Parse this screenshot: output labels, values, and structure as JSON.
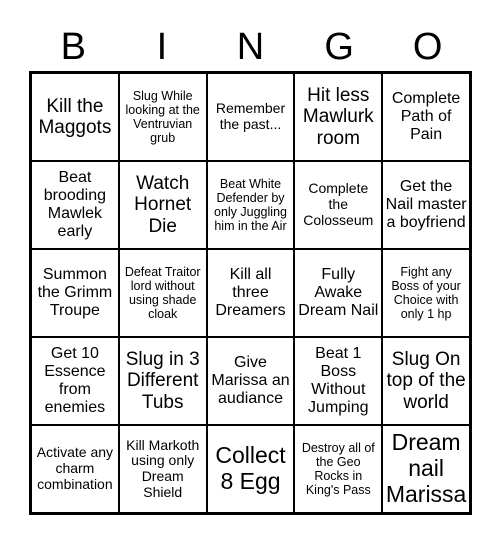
{
  "header": {
    "letters": [
      "B",
      "I",
      "N",
      "G",
      "O"
    ]
  },
  "card": {
    "rows": [
      [
        {
          "text": "Kill the Maggots",
          "size": "lg"
        },
        {
          "text": "Slug While looking at the Ventruvian grub",
          "size": "xs"
        },
        {
          "text": "Remember the past...",
          "size": "sm"
        },
        {
          "text": "Hit less Mawlurk room",
          "size": "lg"
        },
        {
          "text": "Complete Path of Pain",
          "size": "md"
        }
      ],
      [
        {
          "text": "Beat brooding Mawlek early",
          "size": "md"
        },
        {
          "text": "Watch Hornet Die",
          "size": "lg"
        },
        {
          "text": "Beat White Defender by only Juggling him in the Air",
          "size": "xs"
        },
        {
          "text": "Complete the Colosseum",
          "size": "sm"
        },
        {
          "text": "Get the Nail master a boyfriend",
          "size": "md"
        }
      ],
      [
        {
          "text": "Summon the Grimm Troupe",
          "size": "md"
        },
        {
          "text": "Defeat Traitor lord without using shade cloak",
          "size": "xs"
        },
        {
          "text": "Kill all three Dreamers",
          "size": "md"
        },
        {
          "text": "Fully Awake Dream Nail",
          "size": "md"
        },
        {
          "text": "Fight any Boss of your Choice with only 1 hp",
          "size": "xs"
        }
      ],
      [
        {
          "text": "Get 10 Essence from enemies",
          "size": "md"
        },
        {
          "text": "Slug in 3 Different Tubs",
          "size": "lg"
        },
        {
          "text": "Give Marissa an audiance",
          "size": "md"
        },
        {
          "text": "Beat 1 Boss Without Jumping",
          "size": "md"
        },
        {
          "text": "Slug On top of the world",
          "size": "lg"
        }
      ],
      [
        {
          "text": "Activate any charm combination",
          "size": "sm"
        },
        {
          "text": "Kill Markoth using only Dream Shield",
          "size": "sm"
        },
        {
          "text": "Collect 8 Egg",
          "size": "xl"
        },
        {
          "text": "Destroy all of the Geo Rocks in King's Pass",
          "size": "xs"
        },
        {
          "text": "Dream nail Marissa",
          "size": "xl"
        }
      ]
    ]
  }
}
